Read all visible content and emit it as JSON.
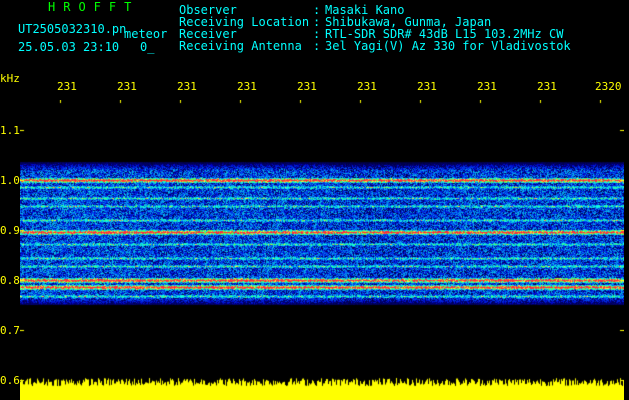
{
  "header": {
    "title": "HROFFT",
    "file_name": "UT2505032310.pn",
    "mode": "meteor",
    "datetime": "25.05.03 23:10",
    "count": "0_"
  },
  "info": [
    {
      "label": "Observer",
      "sep": ":",
      "value": "Masaki Kano"
    },
    {
      "label": "Receiving Location",
      "sep": ":",
      "value": "Shibukawa, Gunma, Japan"
    },
    {
      "label": "Receiver",
      "sep": ":",
      "value": "RTL-SDR SDR# 43dB L15 103.2MHz CW"
    },
    {
      "label": "Receiving Antenna",
      "sep": ":",
      "value": "3el Yagi(V) Az 330 for Vladivostok"
    }
  ],
  "axes": {
    "y_unit": "kHz",
    "x_ticks": [
      "231",
      "231",
      "231",
      "231",
      "231",
      "231",
      "231",
      "231",
      "231",
      "2320"
    ],
    "y_ticks": [
      "1.1",
      "1.0",
      "0.9",
      "0.8",
      "0.7",
      "0.6"
    ]
  },
  "colors": {
    "background": "#000000",
    "noise": "#0000c8",
    "signal_mid": "#00ffff",
    "signal_high": "#ff3030",
    "baseline_bar": "#ffff00"
  }
}
